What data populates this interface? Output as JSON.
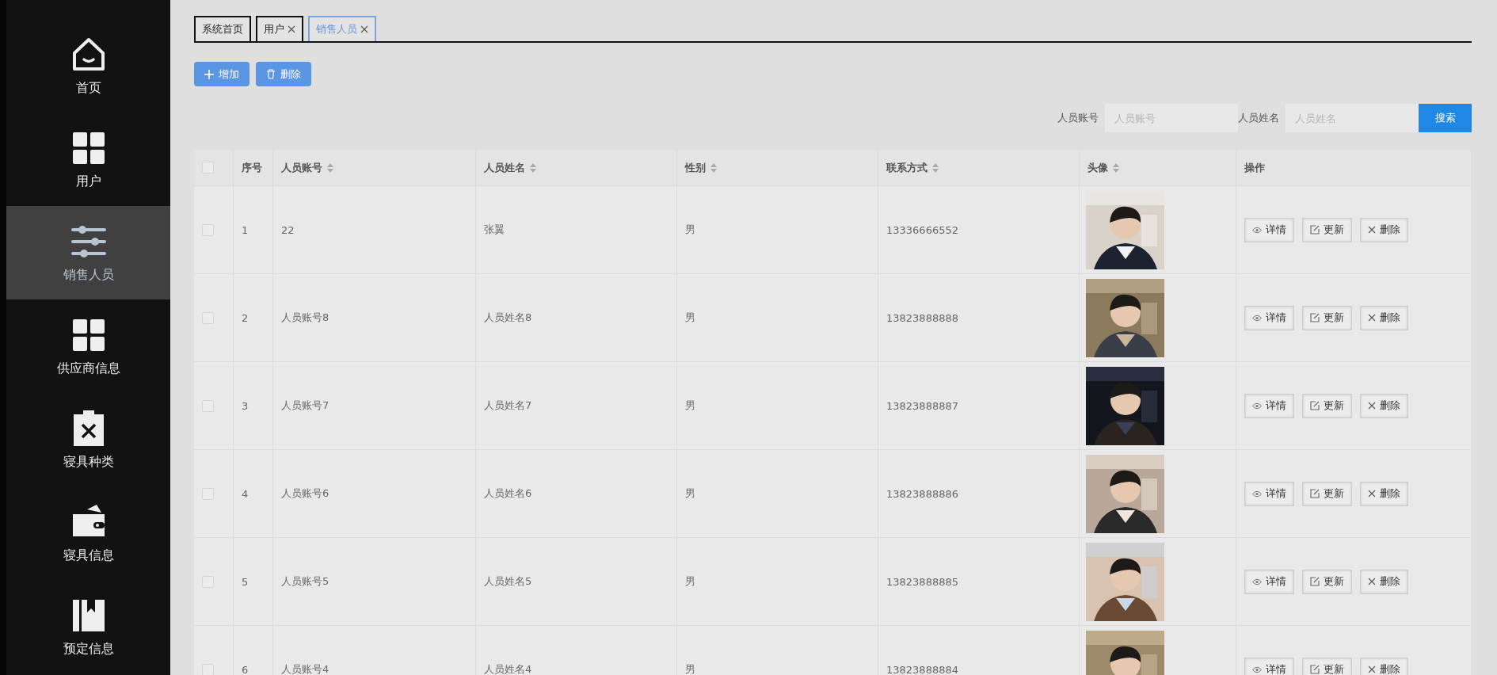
{
  "sidebar": {
    "items": [
      {
        "kind": "home",
        "label": "首页",
        "selected": false
      },
      {
        "kind": "grid",
        "label": "用户",
        "selected": false
      },
      {
        "kind": "sliders",
        "label": "销售人员",
        "selected": true
      },
      {
        "kind": "grid",
        "label": "供应商信息",
        "selected": false
      },
      {
        "kind": "clipboard",
        "label": "寝具种类",
        "selected": false
      },
      {
        "kind": "wallet",
        "label": "寝具信息",
        "selected": false
      },
      {
        "kind": "bookmark",
        "label": "预定信息",
        "selected": false
      }
    ]
  },
  "tabs": [
    {
      "label": "系统首页",
      "closable": false,
      "selected": false
    },
    {
      "label": "用户",
      "closable": true,
      "selected": false
    },
    {
      "label": "销售人员",
      "closable": true,
      "selected": true
    }
  ],
  "actions": [
    {
      "kind": "add",
      "label": "增加"
    },
    {
      "kind": "delete",
      "label": "删除"
    }
  ],
  "search": {
    "fields": [
      {
        "label": "人员账号",
        "placeholder": "人员账号"
      },
      {
        "label": "人员姓名",
        "placeholder": "人员姓名"
      }
    ],
    "button": "搜索"
  },
  "table": {
    "select_all": {
      "checked": false
    },
    "columns": [
      {
        "label": "序号",
        "sortable": false
      },
      {
        "label": "人员账号",
        "sortable": true
      },
      {
        "label": "人员姓名",
        "sortable": true
      },
      {
        "label": "性别",
        "sortable": true
      },
      {
        "label": "联系方式",
        "sortable": true
      },
      {
        "label": "头像",
        "sortable": true
      },
      {
        "label": "操作",
        "sortable": false
      }
    ],
    "rows": [
      {
        "checked": false,
        "index": "1",
        "account": "22",
        "name": "张翼",
        "gender": "男",
        "phone": "13336666552",
        "actions": [
          {
            "kind": "view",
            "label": "详情"
          },
          {
            "kind": "edit",
            "label": "更新"
          },
          {
            "kind": "delete",
            "label": "删除"
          }
        ]
      },
      {
        "checked": false,
        "index": "2",
        "account": "人员账号8",
        "name": "人员姓名8",
        "gender": "男",
        "phone": "13823888888",
        "actions": [
          {
            "kind": "view",
            "label": "详情"
          },
          {
            "kind": "edit",
            "label": "更新"
          },
          {
            "kind": "delete",
            "label": "删除"
          }
        ]
      },
      {
        "checked": false,
        "index": "3",
        "account": "人员账号7",
        "name": "人员姓名7",
        "gender": "男",
        "phone": "13823888887",
        "actions": [
          {
            "kind": "view",
            "label": "详情"
          },
          {
            "kind": "edit",
            "label": "更新"
          },
          {
            "kind": "delete",
            "label": "删除"
          }
        ]
      },
      {
        "checked": false,
        "index": "4",
        "account": "人员账号6",
        "name": "人员姓名6",
        "gender": "男",
        "phone": "13823888886",
        "actions": [
          {
            "kind": "view",
            "label": "详情"
          },
          {
            "kind": "edit",
            "label": "更新"
          },
          {
            "kind": "delete",
            "label": "删除"
          }
        ]
      },
      {
        "checked": false,
        "index": "5",
        "account": "人员账号5",
        "name": "人员姓名5",
        "gender": "男",
        "phone": "13823888885",
        "actions": [
          {
            "kind": "view",
            "label": "详情"
          },
          {
            "kind": "edit",
            "label": "更新"
          },
          {
            "kind": "delete",
            "label": "删除"
          }
        ]
      },
      {
        "checked": false,
        "index": "6",
        "account": "人员账号4",
        "name": "人员姓名4",
        "gender": "男",
        "phone": "13823888884",
        "actions": [
          {
            "kind": "view",
            "label": "详情"
          },
          {
            "kind": "edit",
            "label": "更新"
          },
          {
            "kind": "delete",
            "label": "删除"
          }
        ]
      }
    ]
  }
}
